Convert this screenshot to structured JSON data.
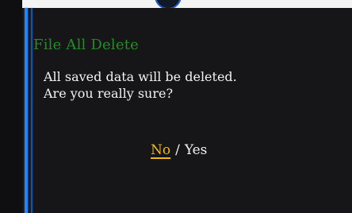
{
  "dialog": {
    "title": "File All Delete",
    "message": [
      "All saved data will be deleted.",
      "Are you really sure?"
    ],
    "options": {
      "no": "No",
      "separator": "/",
      "yes": "Yes"
    },
    "selected": "No"
  },
  "colors": {
    "title": "#1f8f1f",
    "selected_option": "#f0b81a",
    "text": "#f2f2f2",
    "accent_line": "#1f86ff",
    "background": "#161618"
  }
}
